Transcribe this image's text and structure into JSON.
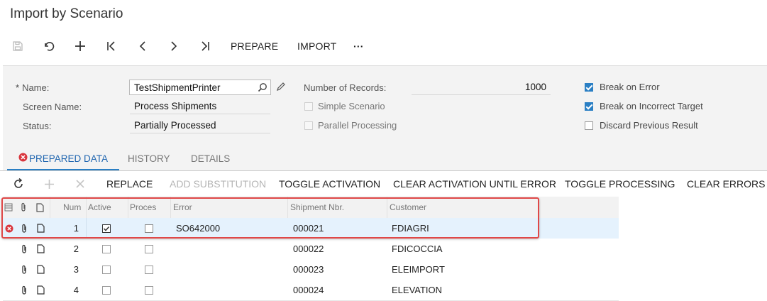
{
  "page": {
    "title": "Import by Scenario"
  },
  "toolbar": {
    "icons": [
      "save-icon",
      "undo-icon",
      "add-icon",
      "first-icon",
      "prev-icon",
      "next-icon",
      "last-icon",
      "more-icon"
    ],
    "prepare_label": "PREPARE",
    "import_label": "IMPORT",
    "more_label": "···"
  },
  "form": {
    "name_label": "Name:",
    "name_required": "*",
    "name_value": "TestShipmentPrinter",
    "screen_label": "Screen Name:",
    "screen_value": "Process Shipments",
    "status_label": "Status:",
    "status_value": "Partially Processed",
    "records_label": "Number of Records:",
    "records_value": "1000",
    "simple_label": "Simple Scenario",
    "parallel_label": "Parallel Processing",
    "break_error_label": "Break on Error",
    "break_target_label": "Break on Incorrect Target",
    "discard_label": "Discard Previous Result",
    "simple_checked": false,
    "parallel_checked": false,
    "break_error_checked": true,
    "break_target_checked": true,
    "discard_checked": false
  },
  "tabs": [
    {
      "label": "PREPARED DATA",
      "active": true,
      "icon": "error-icon"
    },
    {
      "label": "HISTORY",
      "active": false
    },
    {
      "label": "DETAILS",
      "active": false
    }
  ],
  "grid_toolbar": {
    "replace": "REPLACE",
    "add_substitution": "ADD SUBSTITUTION",
    "toggle_activation": "TOGGLE ACTIVATION",
    "clear_activation": "CLEAR ACTIVATION UNTIL ERROR",
    "toggle_processing": "TOGGLE PROCESSING",
    "clear_errors": "CLEAR ERRORS"
  },
  "grid": {
    "columns": [
      "Num",
      "Active",
      "Proces",
      "Error",
      "Shipment Nbr.",
      "Customer"
    ],
    "rows": [
      {
        "num": "1",
        "active": true,
        "processed": false,
        "error": "SO642000",
        "shipment": "000021",
        "customer": "FDIAGRI",
        "has_error": true
      },
      {
        "num": "2",
        "active": false,
        "processed": false,
        "error": "",
        "shipment": "000022",
        "customer": "FDICOCCIA",
        "has_error": false
      },
      {
        "num": "3",
        "active": false,
        "processed": false,
        "error": "",
        "shipment": "000023",
        "customer": "ELEIMPORT",
        "has_error": false
      },
      {
        "num": "4",
        "active": false,
        "processed": false,
        "error": "",
        "shipment": "000024",
        "customer": "ELEVATION",
        "has_error": false
      }
    ]
  },
  "colors": {
    "accent": "#2a7fc4",
    "error": "#d9363e",
    "highlight": "#e04848",
    "selected_row": "#e5f2fd"
  }
}
